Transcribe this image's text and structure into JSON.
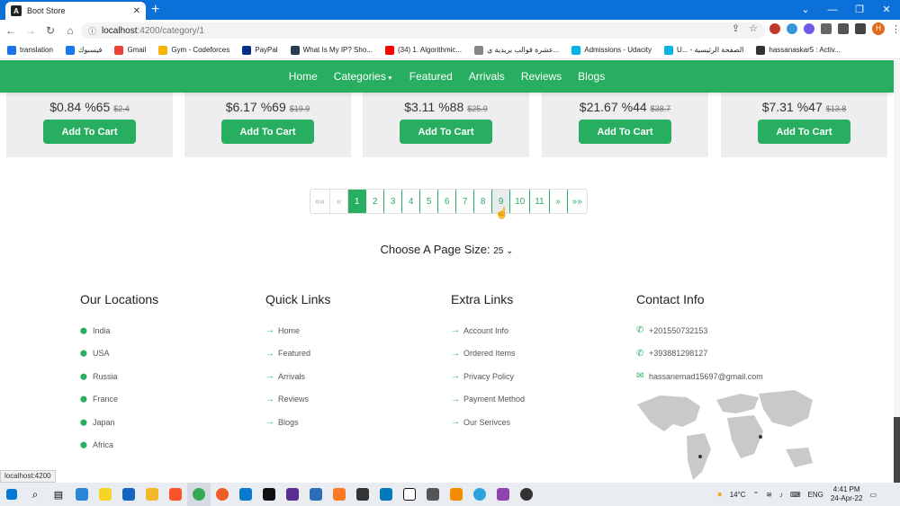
{
  "browser": {
    "tab_title": "Boot Store",
    "url_host": "localhost",
    "url_path": ":4200/category/1",
    "profile_initial": "H"
  },
  "bookmarks": [
    {
      "label": "translation",
      "color": "#1a73e8"
    },
    {
      "label": "فيسبوك",
      "color": "#1877f2"
    },
    {
      "label": "Gmail",
      "color": "#ea4335"
    },
    {
      "label": "Gym - Codeforces",
      "color": "#f4b400"
    },
    {
      "label": "PayPal",
      "color": "#003087"
    },
    {
      "label": "What Is My IP? Sho...",
      "color": "#2c3e50"
    },
    {
      "label": "(34) 1. Algorithmic...",
      "color": "#ff0000"
    },
    {
      "label": "عشرة قوالب بريدية ي...",
      "color": "#888888"
    },
    {
      "label": "Admissions - Udacity",
      "color": "#02b3e4"
    },
    {
      "label": "U... - الصفحة الرئيسية",
      "color": "#02b3e4"
    },
    {
      "label": "hassanaskar5 : Activ...",
      "color": "#333333"
    }
  ],
  "navbar": {
    "items": [
      "Home",
      "Categories",
      "Featured",
      "Arrivals",
      "Reviews",
      "Blogs"
    ]
  },
  "products": [
    {
      "price": "$0.84",
      "discount": "%65",
      "old_price": "$2.4",
      "button": "Add To Cart"
    },
    {
      "price": "$6.17",
      "discount": "%69",
      "old_price": "$19.9",
      "button": "Add To Cart"
    },
    {
      "price": "$3.11",
      "discount": "%88",
      "old_price": "$25.9",
      "button": "Add To Cart"
    },
    {
      "price": "$21.67",
      "discount": "%44",
      "old_price": "$38.7",
      "button": "Add To Cart"
    },
    {
      "price": "$7.31",
      "discount": "%47",
      "old_price": "$13.8",
      "button": "Add To Cart"
    }
  ],
  "pagination": {
    "first": "««",
    "prev": "«",
    "pages": [
      "1",
      "2",
      "3",
      "4",
      "5",
      "6",
      "7",
      "8",
      "9",
      "10",
      "11"
    ],
    "next": "»",
    "last": "»»",
    "active": "1",
    "hovered": "9"
  },
  "page_size": {
    "label": "Choose A Page Size:",
    "value": "25"
  },
  "footer": {
    "locations": {
      "title": "Our Locations",
      "items": [
        "India",
        "USA",
        "Russia",
        "France",
        "Japan",
        "Africa"
      ]
    },
    "quick_links": {
      "title": "Quick Links",
      "items": [
        "Home",
        "Featured",
        "Arrivals",
        "Reviews",
        "Blogs"
      ]
    },
    "extra_links": {
      "title": "Extra Links",
      "items": [
        "Account Info",
        "Ordered Items",
        "Privacy Policy",
        "Payment Method",
        "Our Serivces"
      ]
    },
    "contact": {
      "title": "Contact Info",
      "items": [
        "+201550732153",
        "+393881298127",
        "hassanemad15697@gmail.com"
      ]
    }
  },
  "status_link": "localhost:4200",
  "taskbar": {
    "weather": "14°C",
    "lang": "ENG",
    "time": "4:41 PM",
    "date": "24-Apr-22"
  },
  "colors": {
    "brand": "#27ae60",
    "card_bg": "#eeeeee"
  }
}
